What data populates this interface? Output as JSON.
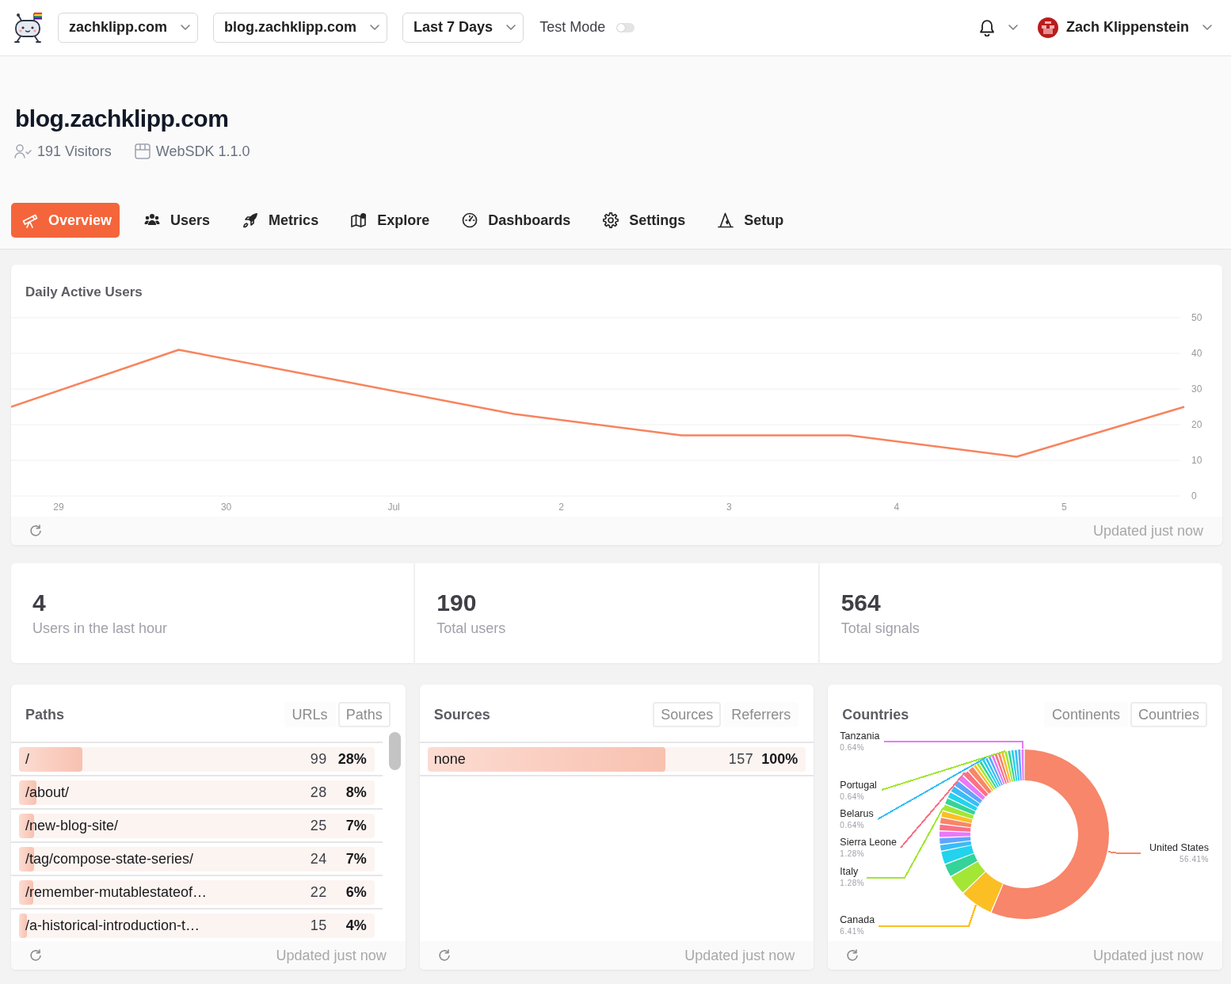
{
  "top_bar": {
    "dropdowns": [
      {
        "label": "zachklipp.com"
      },
      {
        "label": "blog.zachklipp.com"
      },
      {
        "label": "Last 7 Days"
      }
    ],
    "test_mode": {
      "label": "Test Mode",
      "on": false
    },
    "user": {
      "name": "Zach Klippenstein"
    }
  },
  "page_header": {
    "title": "blog.zachklipp.com",
    "visitors": "191 Visitors",
    "sdk_version": "WebSDK 1.1.0"
  },
  "tabs": [
    {
      "label": "Overview",
      "selected": true
    },
    {
      "label": "Users",
      "selected": false
    },
    {
      "label": "Metrics",
      "selected": false
    },
    {
      "label": "Explore",
      "selected": false
    },
    {
      "label": "Dashboards",
      "selected": false
    },
    {
      "label": "Settings",
      "selected": false
    },
    {
      "label": "Setup",
      "selected": false
    }
  ],
  "daily_active_users": {
    "chart_data": {
      "type": "line",
      "title": "Daily Active Users",
      "categories": [
        "29",
        "30",
        "Jul",
        "2",
        "3",
        "4",
        "5",
        null
      ],
      "series": [
        {
          "color": "#f7845e",
          "values": [
            25,
            41,
            32,
            23,
            17,
            17,
            11,
            25
          ]
        }
      ],
      "ylim": [
        0,
        50
      ],
      "yticks": [
        0,
        10,
        20,
        30,
        40,
        50
      ],
      "grid": true
    },
    "updated": "Updated just now"
  },
  "stats": [
    {
      "value": "4",
      "label": "Users in the last hour"
    },
    {
      "value": "190",
      "label": "Total users"
    },
    {
      "value": "564",
      "label": "Total signals"
    }
  ],
  "paths": {
    "title": "Paths",
    "toggle": [
      {
        "label": "URLs",
        "selected": false
      },
      {
        "label": "Paths",
        "selected": true
      }
    ],
    "rows": [
      {
        "label": "/",
        "count": "99",
        "share": "28%",
        "level": 0.179
      },
      {
        "label": "/about/",
        "count": "28",
        "share": "8%",
        "level": 0.049
      },
      {
        "label": "/new-blog-site/",
        "count": "25",
        "share": "7%",
        "level": 0.043
      },
      {
        "label": "/tag/compose-state-series/",
        "count": "24",
        "share": "7%",
        "level": 0.042
      },
      {
        "label": "/remember-mutablestateof…",
        "count": "22",
        "share": "6%",
        "level": 0.04
      },
      {
        "label": "/a-historical-introduction-t…",
        "count": "15",
        "share": "4%",
        "level": 0.022
      }
    ],
    "updated": "Updated just now"
  },
  "sources": {
    "title": "Sources",
    "toggle": [
      {
        "label": "Sources",
        "selected": true
      },
      {
        "label": "Referrers",
        "selected": false
      }
    ],
    "rows": [
      {
        "label": "none",
        "count": "157",
        "share": "100%",
        "level": 0.628
      }
    ],
    "updated": "Updated just now"
  },
  "countries": {
    "title": "Countries",
    "toggle": [
      {
        "label": "Continents",
        "selected": false
      },
      {
        "label": "Countries",
        "selected": true
      }
    ],
    "labels": [
      {
        "name": "Tanzania",
        "share": "0.64%",
        "color": "#e879f9"
      },
      {
        "name": "Portugal",
        "share": "0.64%",
        "color": "#a3e635"
      },
      {
        "name": "Belarus",
        "share": "0.64%",
        "color": "#38bdf8"
      },
      {
        "name": "Sierra Leone",
        "share": "1.28%",
        "color": "#fb7185"
      },
      {
        "name": "Italy",
        "share": "1.28%",
        "color": "#a3e635"
      },
      {
        "name": "Canada",
        "share": "6.41%",
        "color": "#fbbf24"
      },
      {
        "name": "United States",
        "share": "56.41%",
        "color": "#f7866a"
      }
    ],
    "updated": "Updated just now"
  }
}
